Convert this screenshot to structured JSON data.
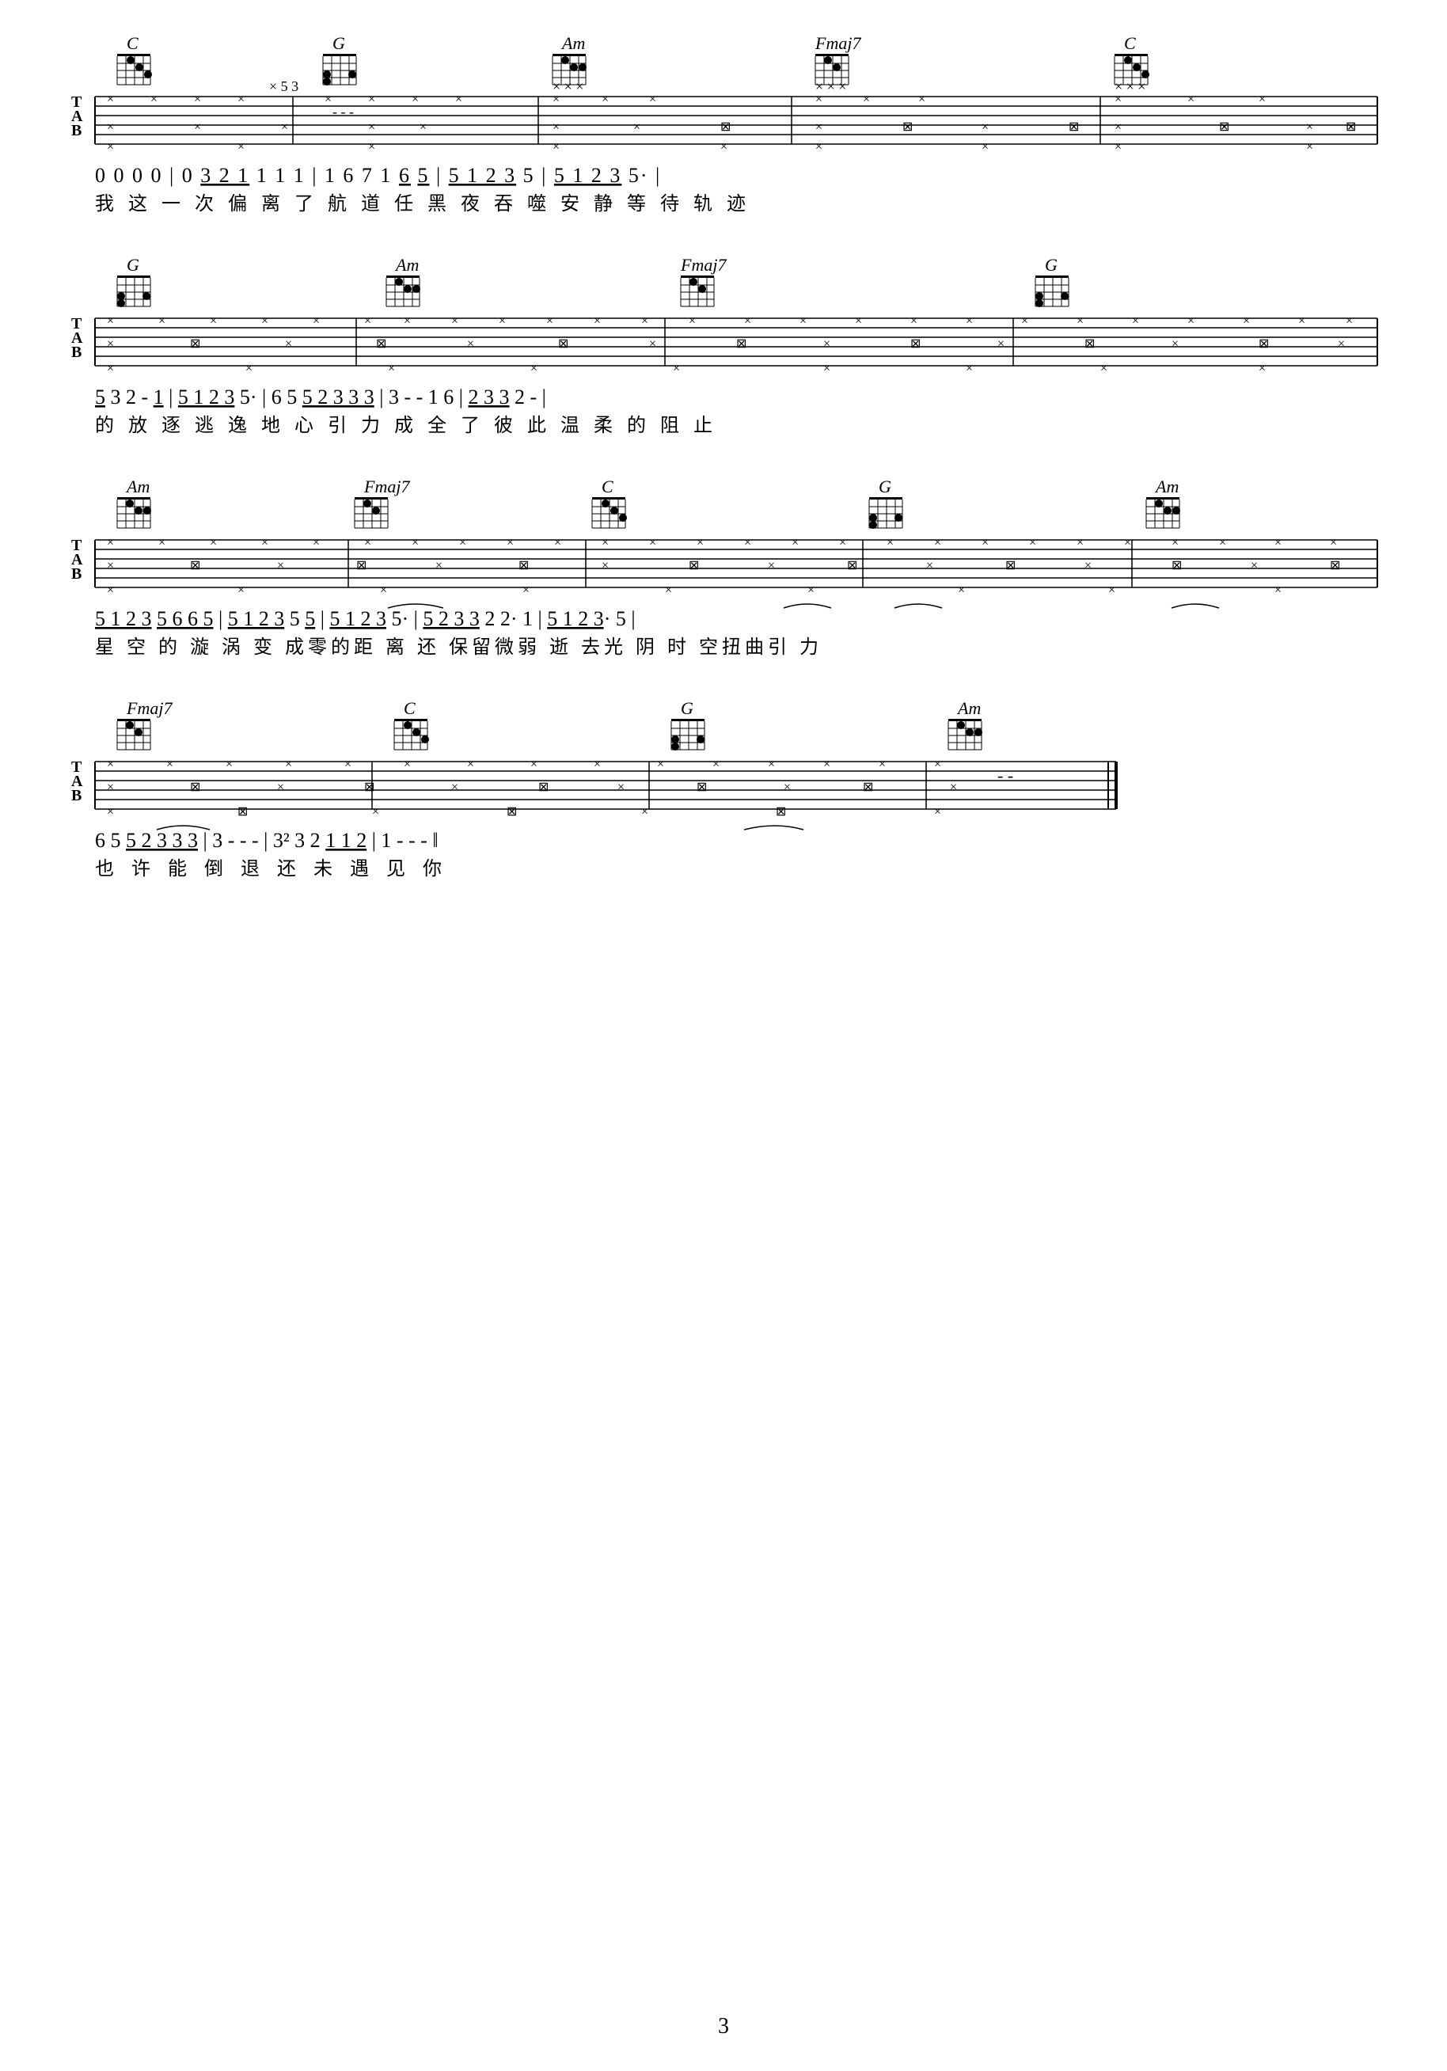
{
  "page": {
    "number": "3",
    "background": "#ffffff"
  },
  "sections": [
    {
      "id": "section1",
      "chords": [
        "C",
        "G",
        "Am",
        "Fmaj7",
        "C"
      ],
      "notation": "0 0 0 0 | 0  3 2 1 1 1 1 | 1 6 7 1  6  5 | 5 1 2 3  5  | 5 1 2 3  5· |",
      "lyrics": "我 这 一 次   偏 离 了 航  道    任 黑 夜 吞 噬  安 静 等 待 轨  迹"
    },
    {
      "id": "section2",
      "chords": [
        "G",
        "Am",
        "Fmaj7",
        "G"
      ],
      "notation": "5 3 2 -  1 | 5 1 2 3  5·  | 6  5  5 2 3 3 3 | 3 - - 1 6  | 2 3 3  2 - |",
      "lyrics": "的 放  逐    逃 逸 地 心 引  力    成 全  了 彼  此      温 柔  的 阻  止"
    },
    {
      "id": "section3",
      "chords": [
        "Am",
        "Fmaj7",
        "C",
        "G",
        "Am"
      ],
      "notation": "5 1 2 3  5 6 6 5 | 5 1 2 3  5  5 | 5 1 2 3  5· | 5 2 3 3  2 2·  1 | 5 1 2 3·  5 |",
      "lyrics": "星 空 的 漩  涡   变 成零的距 离  还 保留微弱 逝    去光  阴  时 空扭曲引  力"
    },
    {
      "id": "section4",
      "chords": [
        "Fmaj7",
        "C",
        "G",
        "Am"
      ],
      "notation": "6  5  5 2 3 3 3 | 3 - - -  | 3² 3  2  1 1 2 | 1 - - - ‖",
      "lyrics": "也 许  能 倒  退        还  未  遇 见 你"
    }
  ]
}
